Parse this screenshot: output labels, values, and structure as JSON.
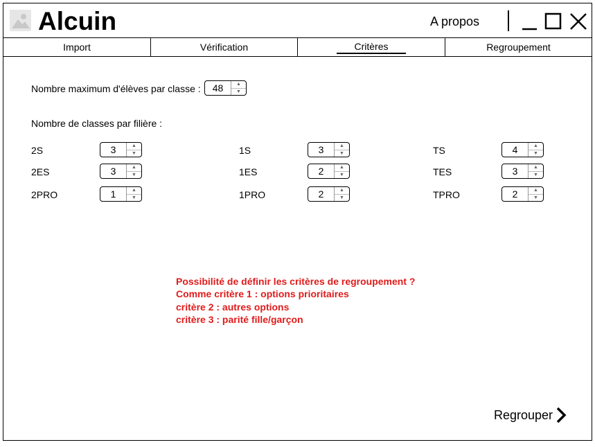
{
  "app": {
    "title": "Alcuin",
    "about_label": "A propos"
  },
  "tabs": [
    {
      "label": "Import",
      "active": false
    },
    {
      "label": "Vérification",
      "active": false
    },
    {
      "label": "Critères",
      "active": true
    },
    {
      "label": "Regroupement",
      "active": false
    }
  ],
  "max_students": {
    "label": "Nombre maximum d'élèves par classe :",
    "value": "48"
  },
  "classes_section": {
    "label": "Nombre de classes par filière :"
  },
  "filieres": [
    {
      "label": "2S",
      "value": "3"
    },
    {
      "label": "2ES",
      "value": "3"
    },
    {
      "label": "2PRO",
      "value": "1"
    },
    {
      "label": "1S",
      "value": "3"
    },
    {
      "label": "1ES",
      "value": "2"
    },
    {
      "label": "1PRO",
      "value": "2"
    },
    {
      "label": "TS",
      "value": "4"
    },
    {
      "label": "TES",
      "value": "3"
    },
    {
      "label": "TPRO",
      "value": "2"
    }
  ],
  "note": [
    "Possibilité de définir les critères de regroupement ?",
    "Comme critère 1 : options prioritaires",
    "critère 2 : autres options",
    "critère 3 : parité fille/garçon"
  ],
  "regroup_button": {
    "label": "Regrouper"
  },
  "colors": {
    "note": "#e01b1b",
    "border": "#000000",
    "logo_bg": "#e6e6e6"
  },
  "icons": [
    "image-placeholder-icon",
    "minimize-icon",
    "maximize-icon",
    "close-icon",
    "chevron-right-icon"
  ]
}
